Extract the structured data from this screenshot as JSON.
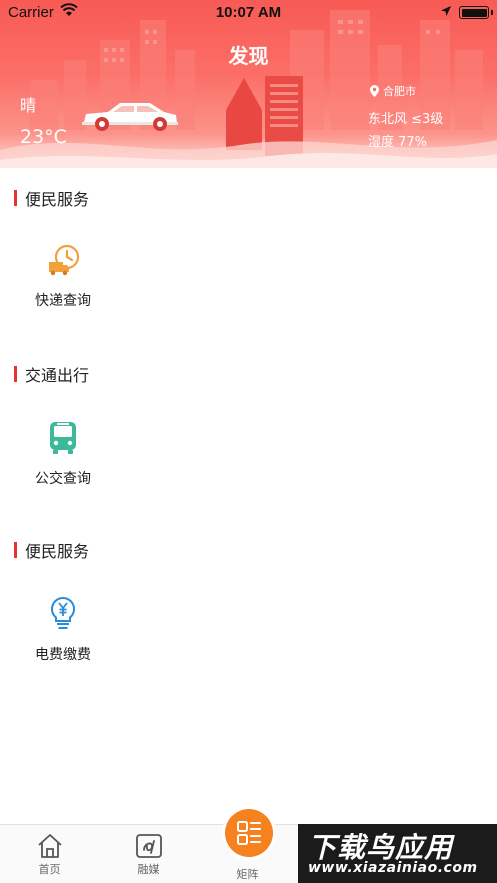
{
  "status_bar": {
    "carrier": "Carrier",
    "time": "10:07 AM"
  },
  "header": {
    "title": "发现"
  },
  "weather": {
    "condition": "晴",
    "temperature": "23°C",
    "city": "合肥市",
    "wind": "东北风 ≤3级",
    "humidity": "湿度 77%"
  },
  "sections": [
    {
      "title": "便民服务",
      "items": [
        {
          "label": "快递查询",
          "icon": "delivery-truck-clock-icon",
          "color": "#f0a23a"
        }
      ]
    },
    {
      "title": "交通出行",
      "items": [
        {
          "label": "公交查询",
          "icon": "bus-icon",
          "color": "#3cb89a"
        }
      ]
    },
    {
      "title": "便民服务",
      "items": [
        {
          "label": "电费缴费",
          "icon": "lightbulb-yen-icon",
          "color": "#2a8ddc"
        }
      ]
    }
  ],
  "tabbar": {
    "tabs": [
      {
        "label": "首页",
        "icon": "home-icon"
      },
      {
        "label": "融媒",
        "icon": "media-icon"
      },
      {
        "label": "矩阵",
        "icon": "grid-icon"
      }
    ],
    "accent": "#f5811f"
  },
  "watermark": {
    "big": "下载鸟应用",
    "small": "www.xiazainiao.com"
  },
  "colors": {
    "header_gradient_top": "#f85a55",
    "section_bar": "#e8322c"
  }
}
